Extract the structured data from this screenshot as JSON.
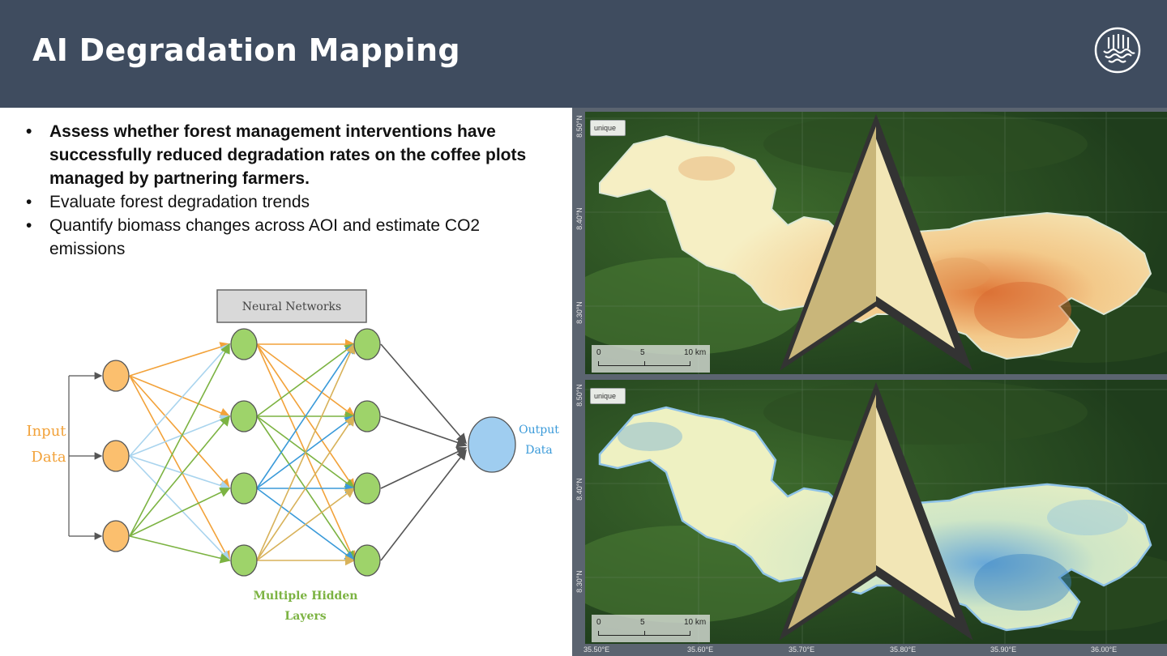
{
  "header": {
    "title": "AI Degradation Mapping",
    "background": "#3f4c5f"
  },
  "bullets": [
    {
      "text": "Assess whether forest management interventions have successfully reduced degradation rates on the coffee plots managed by partnering farmers.",
      "bold": true
    },
    {
      "text": "Evaluate forest degradation trends",
      "bold": false
    },
    {
      "text": "Quantify biomass changes across AOI and estimate CO2 emissions",
      "bold": false
    }
  ],
  "diagram": {
    "header_label": "Neural Networks",
    "input_label_line1": "Input",
    "input_label_line2": "Data",
    "output_label_line1": "Output",
    "output_label_line2": "Data",
    "hidden_label_line1": "Multiple Hidden",
    "hidden_label_line2": "Layers",
    "colors": {
      "input": "#fbbf6e",
      "hidden": "#9ed36a",
      "output": "#9fcdf0",
      "orange": "#f2a23a",
      "green": "#7cb342",
      "blue": "#3a9ad9",
      "lightblue": "#a9d4ee",
      "gray": "#555555"
    }
  },
  "maps": {
    "logo_text": "unique",
    "scale": {
      "zero": "0",
      "mid": "5",
      "end": "10 km"
    },
    "lat_labels": [
      "8.50°N",
      "8.40°N",
      "8.30°N"
    ],
    "lon_labels": [
      "35.50°E",
      "35.60°E",
      "35.70°E",
      "35.80°E",
      "35.90°E",
      "36.00°E"
    ]
  }
}
